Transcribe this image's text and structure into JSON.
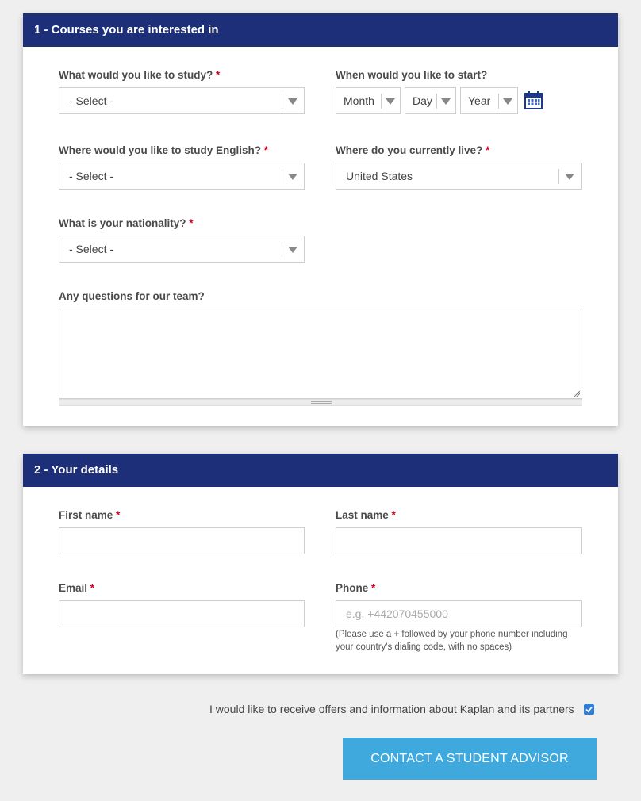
{
  "section1": {
    "title": "1 - Courses you are interested in",
    "study": {
      "label": "What would you like to study?",
      "required": "*",
      "value": "- Select -"
    },
    "start": {
      "label": "When would you like to start?",
      "month": "Month",
      "day": "Day",
      "year": "Year",
      "icon": "calendar-icon"
    },
    "where_study": {
      "label": "Where would you like to study English?",
      "required": "*",
      "value": "- Select -"
    },
    "live": {
      "label": "Where do you currently live?",
      "required": "*",
      "value": "United States"
    },
    "nationality": {
      "label": "What is your nationality?",
      "required": "*",
      "value": "- Select -"
    },
    "questions": {
      "label": "Any questions for our team?",
      "value": ""
    }
  },
  "section2": {
    "title": "2 - Your details",
    "first_name": {
      "label": "First name",
      "required": "*",
      "value": ""
    },
    "last_name": {
      "label": "Last name",
      "required": "*",
      "value": ""
    },
    "email": {
      "label": "Email",
      "required": "*",
      "value": ""
    },
    "phone": {
      "label": "Phone",
      "required": "*",
      "placeholder": "e.g. +442070455000",
      "hint_line1": "(Please use a + followed by your phone number including",
      "hint_line2": "your country's dialing code, with no spaces)"
    }
  },
  "consent": {
    "label": "I would like to receive offers and information about Kaplan and its partners",
    "checked": true
  },
  "cta": {
    "label": "CONTACT A STUDENT ADVISOR"
  },
  "colors": {
    "header": "#1c2f78",
    "cta": "#3fa9dd",
    "required": "#d0021b",
    "checkbox": "#2f7ed8"
  }
}
